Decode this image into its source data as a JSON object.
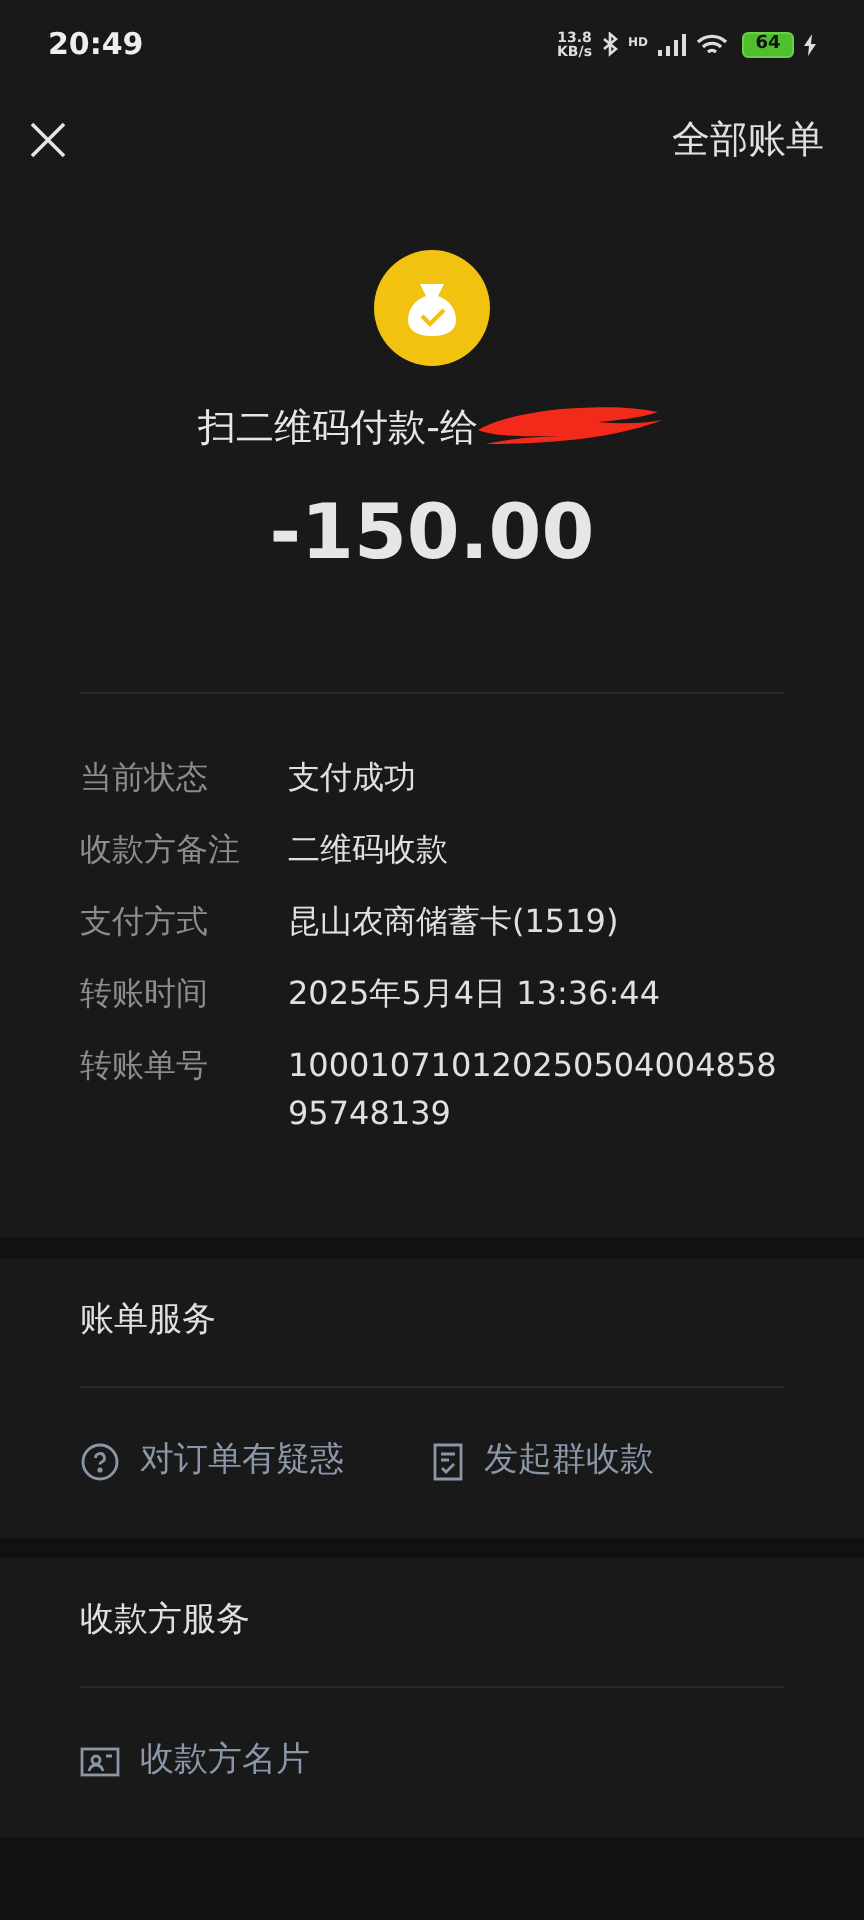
{
  "status_bar": {
    "time": "20:49",
    "net_speed": "13.8",
    "net_unit": "KB/s",
    "signal_label": "HD",
    "battery": "64"
  },
  "header": {
    "action": "全部账单"
  },
  "payment": {
    "title": "扫二维码付款-给",
    "amount": "-150.00"
  },
  "details": [
    {
      "label": "当前状态",
      "value": "支付成功"
    },
    {
      "label": "收款方备注",
      "value": "二维码收款"
    },
    {
      "label": "支付方式",
      "value": "昆山农商储蓄卡(1519)"
    },
    {
      "label": "转账时间",
      "value": "2025年5月4日 13:36:44"
    },
    {
      "label": "转账单号",
      "value": "10001071012025050400485895748139"
    }
  ],
  "sections": [
    {
      "title": "账单服务",
      "actions": [
        {
          "kind": "help",
          "label": "对订单有疑惑"
        },
        {
          "kind": "group",
          "label": "发起群收款"
        }
      ]
    },
    {
      "title": "收款方服务",
      "actions": [
        {
          "kind": "card",
          "label": "收款方名片"
        }
      ]
    }
  ]
}
